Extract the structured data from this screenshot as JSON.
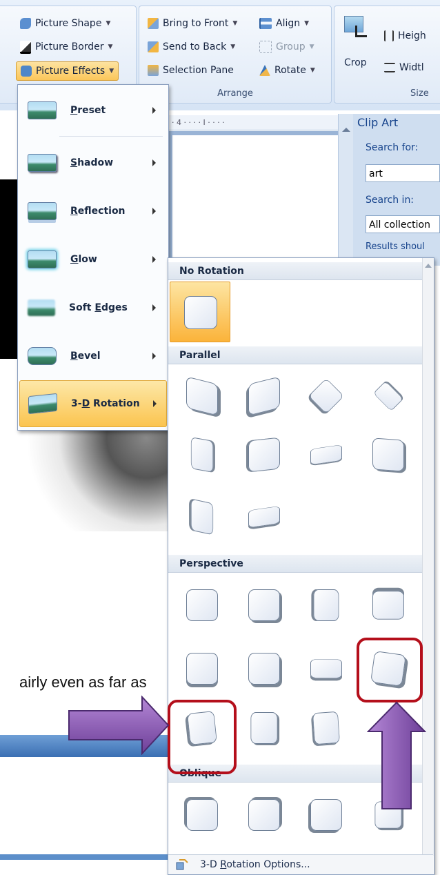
{
  "ribbon": {
    "picture_styles": {
      "shape_label": "Picture Shape",
      "border_label": "Picture Border",
      "effects_label": "Picture Effects"
    },
    "arrange": {
      "bring_front_label": "Bring to Front",
      "send_back_label": "Send to Back",
      "selection_pane_label": "Selection Pane",
      "align_label": "Align",
      "group_label": "Group",
      "rotate_label": "Rotate",
      "group_title": "Arrange"
    },
    "size": {
      "crop_label": "Crop",
      "height_label": "Heigh",
      "width_label": "Widtl",
      "group_title": "Size"
    }
  },
  "ruler": {
    "text": "· 4 · · · · I · · · ·"
  },
  "clip_art": {
    "title": "Clip Art",
    "search_for_label": "Search for:",
    "search_value": "art",
    "search_in_label": "Search in:",
    "search_in_value": "All collection",
    "results_label": "Results shoul"
  },
  "document": {
    "body_text": "airly even as far as"
  },
  "effects_menu": {
    "items": [
      {
        "label": "Preset",
        "accel": "P"
      },
      {
        "label": "Shadow",
        "accel": "S"
      },
      {
        "label": "Reflection",
        "accel": "R"
      },
      {
        "label": "Glow",
        "accel": "G"
      },
      {
        "label": "Soft Edges",
        "accel": "E"
      },
      {
        "label": "Bevel",
        "accel": "B"
      },
      {
        "label": "3-D Rotation",
        "accel": "D"
      }
    ],
    "active_item": "3-D Rotation"
  },
  "rotation_gallery": {
    "sections": {
      "no_rotation": "No Rotation",
      "parallel": "Parallel",
      "perspective": "Perspective",
      "oblique": "Oblique"
    },
    "footer_label": "3-D Rotation Options..."
  },
  "colors": {
    "highlight_orange": "#fbc65a",
    "annotation_red": "#b40f1b",
    "arrow_purple": "#7a4fa0",
    "ribbon_blue": "#d6e4f5"
  },
  "icons": [
    "picture-shape-icon",
    "picture-border-icon",
    "picture-effects-icon",
    "bring-to-front-icon",
    "send-to-back-icon",
    "selection-pane-icon",
    "align-icon",
    "group-icon",
    "rotate-icon",
    "crop-icon",
    "height-icon",
    "width-icon",
    "submenu-arrow-icon",
    "rotation-options-icon"
  ]
}
